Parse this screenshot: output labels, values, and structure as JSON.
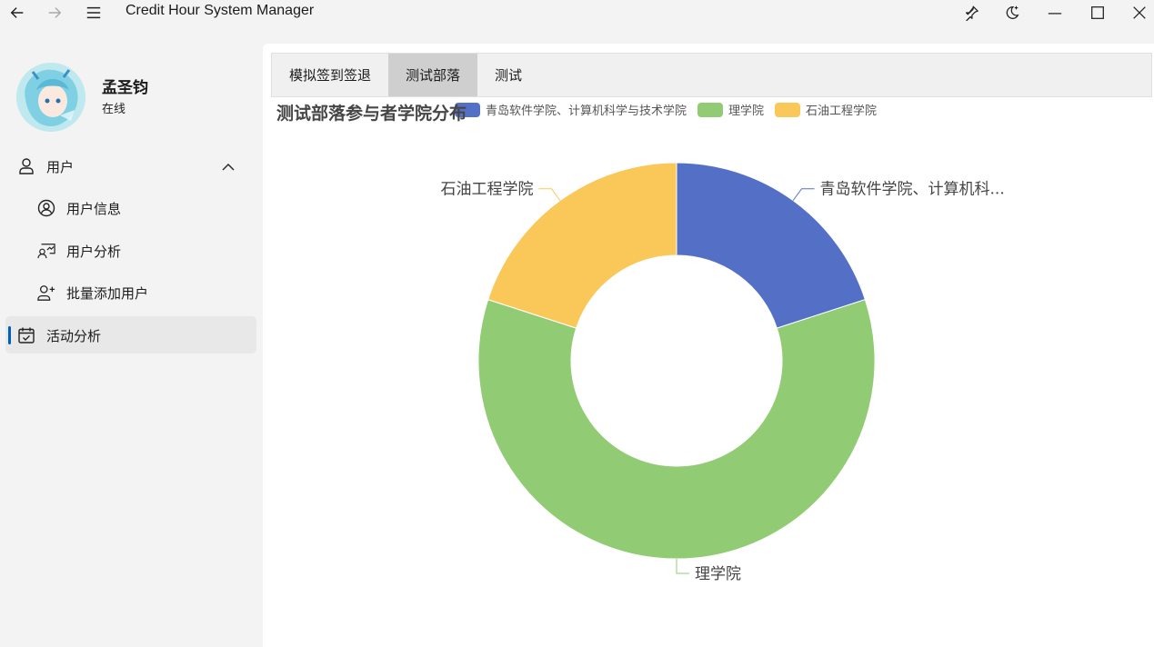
{
  "window": {
    "title": "Credit Hour System Manager",
    "icons": [
      "back-arrow-icon",
      "forward-arrow-icon",
      "hamburger-menu-icon",
      "pin-icon",
      "theme-toggle-icon",
      "minimize-icon",
      "maximize-icon",
      "close-icon"
    ]
  },
  "user": {
    "name": "孟圣钧",
    "status": "在线"
  },
  "sidebar": {
    "group_label": "用户",
    "sub_items": [
      {
        "label": "用户信息",
        "icon": "user-circle-icon"
      },
      {
        "label": "用户分析",
        "icon": "user-chart-icon"
      },
      {
        "label": "批量添加用户",
        "icon": "user-add-icon"
      }
    ],
    "active_item": {
      "label": "活动分析",
      "icon": "calendar-check-icon"
    }
  },
  "tabs": [
    {
      "label": "模拟签到签退",
      "active": false
    },
    {
      "label": "测试部落",
      "active": true
    },
    {
      "label": "测试",
      "active": false
    }
  ],
  "chart_data": {
    "type": "pie",
    "variant": "donut",
    "title": "测试部落参与者学院分布",
    "legend_position": "top",
    "series": [
      {
        "name": "青岛软件学院、计算机科学与技术学院",
        "label": "青岛软件学院、计算机科...",
        "value": 1,
        "color": "#5470c6"
      },
      {
        "name": "理学院",
        "label": "理学院",
        "value": 3,
        "color": "#91cc75"
      },
      {
        "name": "石油工程学院",
        "label": "石油工程学院",
        "value": 1,
        "color": "#fac858"
      }
    ]
  }
}
